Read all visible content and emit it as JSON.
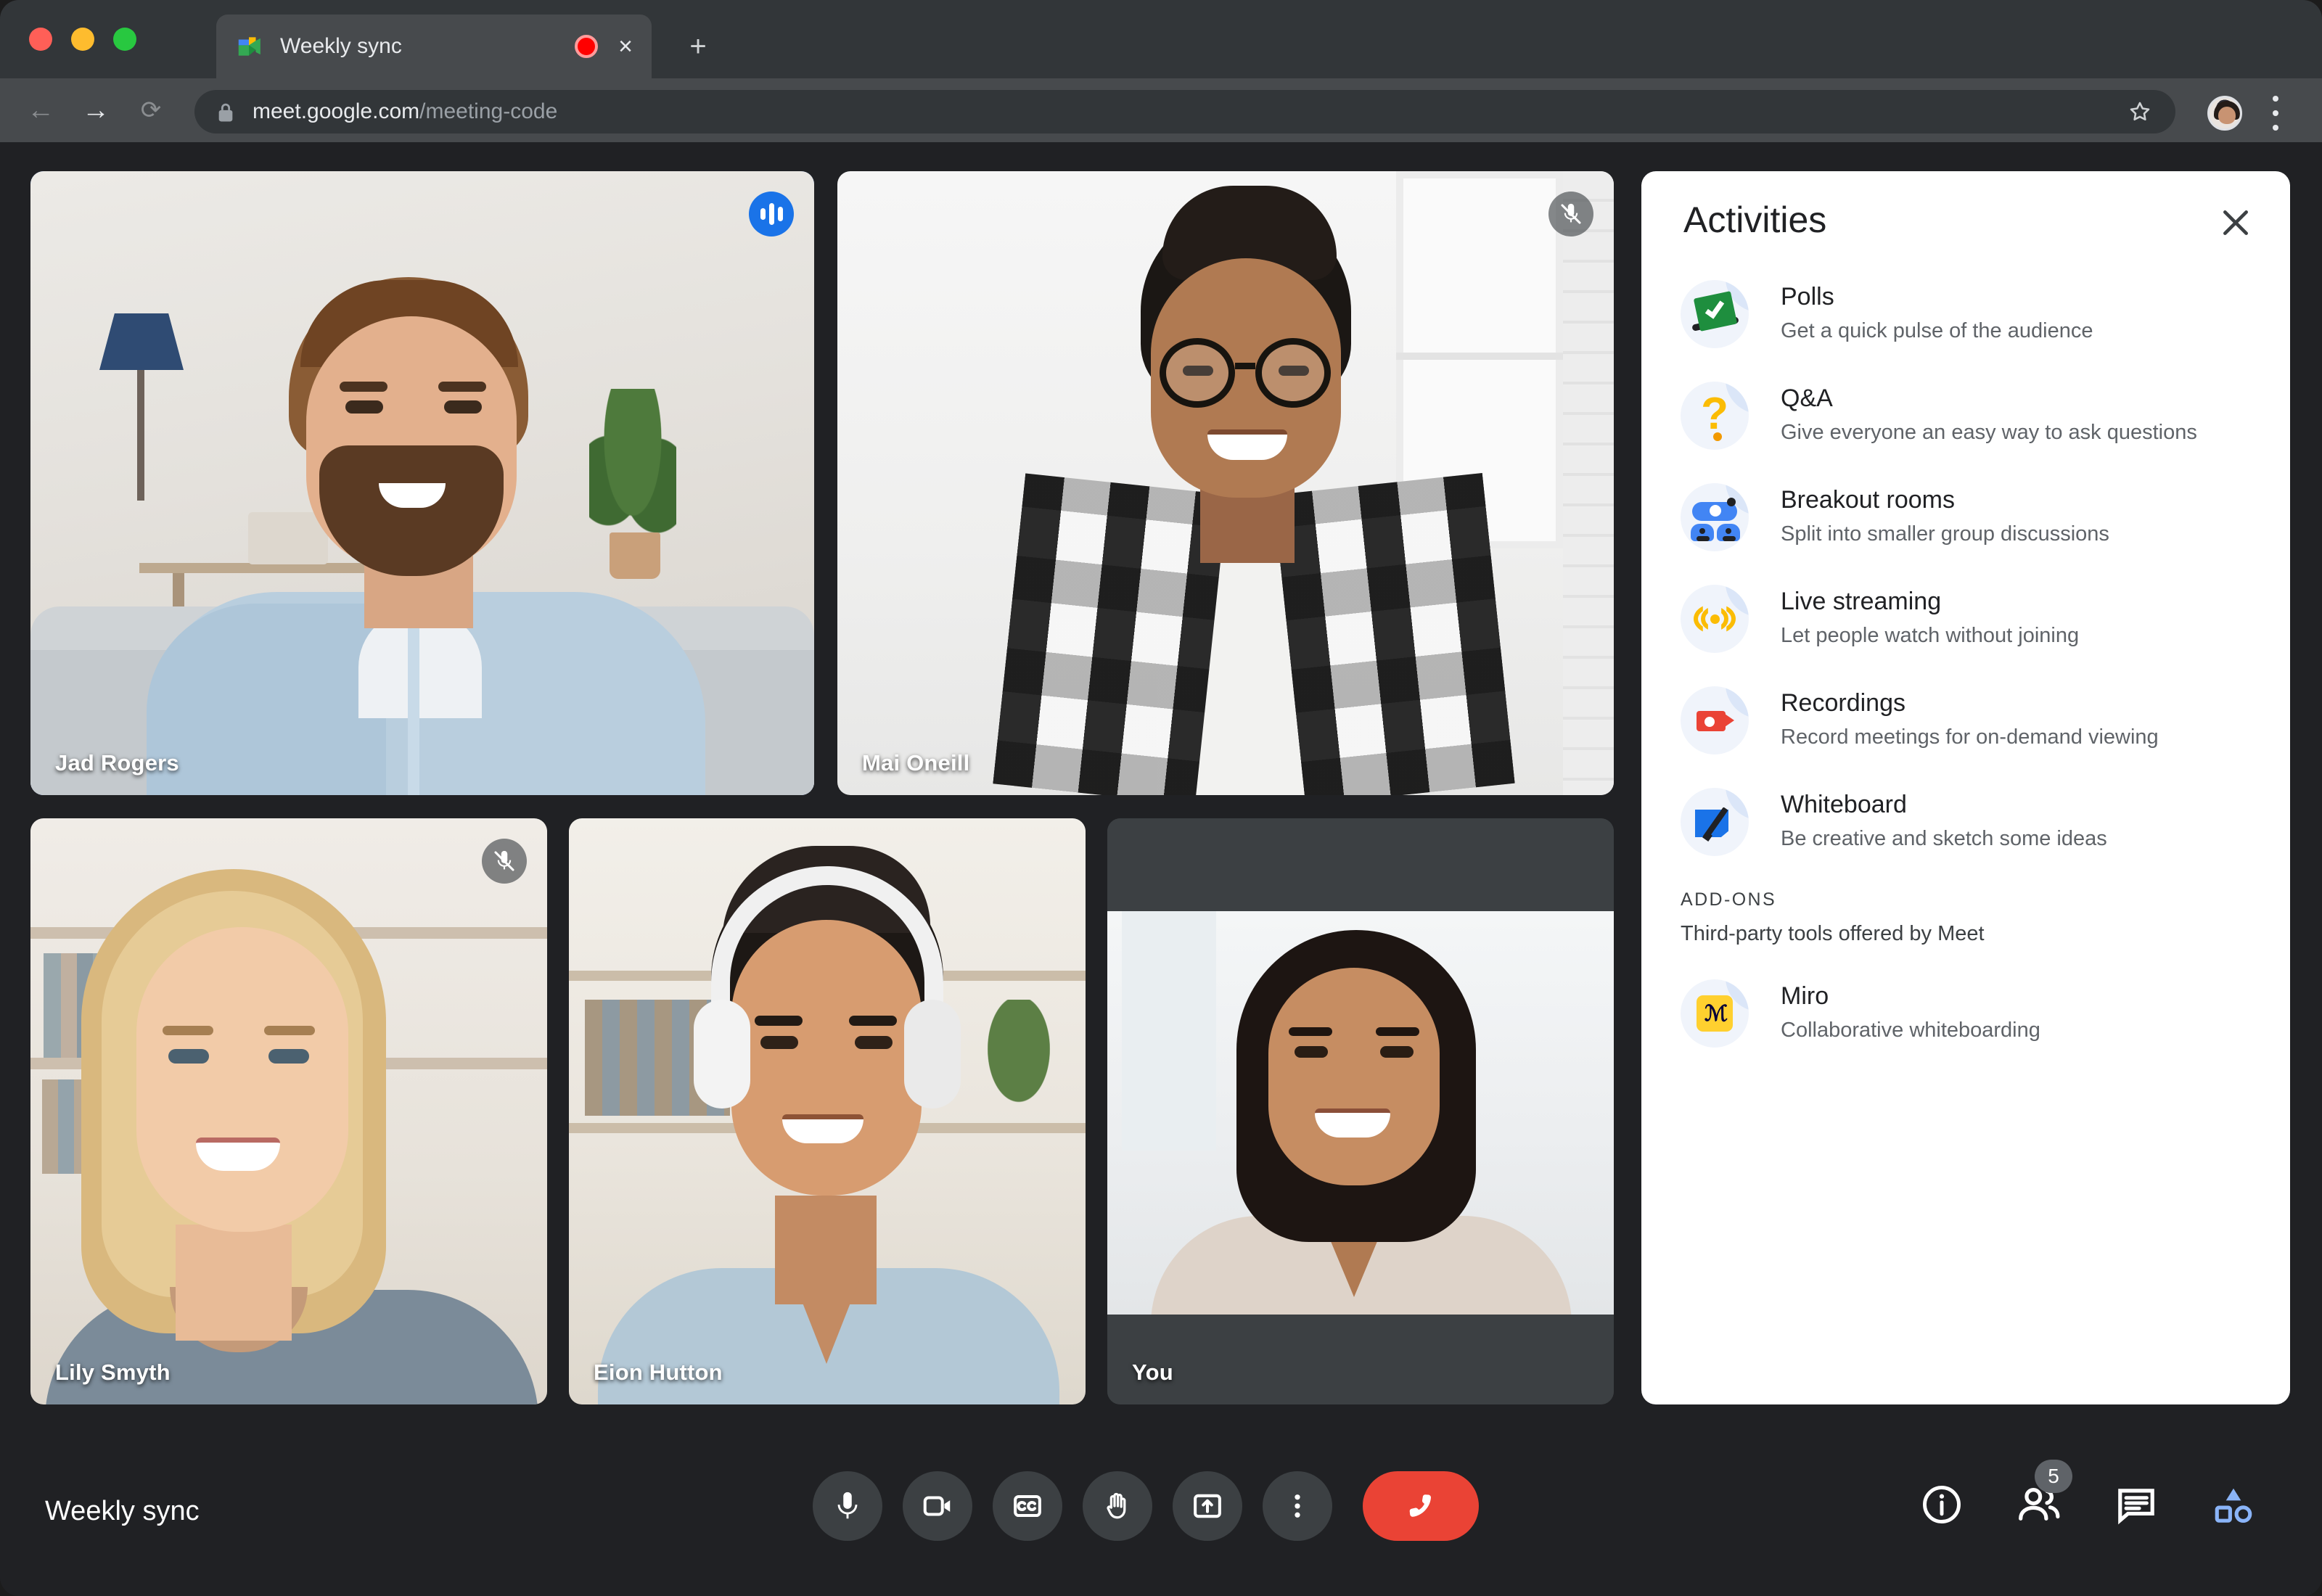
{
  "browser": {
    "tab": {
      "title": "Weekly sync",
      "favicon": "google-meet-favicon",
      "recording_indicator": "recording-dot",
      "close_label": "×"
    },
    "new_tab_label": "+",
    "nav": {
      "back": "←",
      "forward": "→",
      "reload": "⟳"
    },
    "omnibox": {
      "lock": "lock-icon",
      "url_domain": "meet.google.com",
      "url_path": "/meeting-code",
      "bookmark": "star-icon"
    },
    "profile": "avatar",
    "menu": "chrome-menu-icon"
  },
  "meeting": {
    "title": "Weekly sync",
    "participants": [
      {
        "name": "Jad Rogers",
        "mic": "speaking",
        "active_speaker": true
      },
      {
        "name": "Mai Oneill",
        "mic": "muted",
        "active_speaker": false
      },
      {
        "name": "Lily Smyth",
        "mic": "muted",
        "active_speaker": false
      },
      {
        "name": "Eion Hutton",
        "mic": "none",
        "active_speaker": false
      },
      {
        "name": "You",
        "mic": "none",
        "active_speaker": false
      }
    ],
    "controls": [
      {
        "name": "microphone",
        "icon": "mic-icon"
      },
      {
        "name": "camera",
        "icon": "video-camera-icon"
      },
      {
        "name": "captions",
        "icon": "closed-captions-icon"
      },
      {
        "name": "raise-hand",
        "icon": "hand-icon"
      },
      {
        "name": "present",
        "icon": "present-screen-icon"
      },
      {
        "name": "more-options",
        "icon": "more-vertical-icon"
      },
      {
        "name": "leave-call",
        "icon": "hangup-phone-icon"
      }
    ],
    "right_controls": [
      {
        "name": "meeting-details",
        "icon": "info-icon",
        "badge": null
      },
      {
        "name": "people",
        "icon": "people-icon",
        "badge": "5"
      },
      {
        "name": "chat",
        "icon": "chat-bubble-icon",
        "badge": null
      },
      {
        "name": "activities",
        "icon": "activities-shapes-icon",
        "badge": null
      }
    ]
  },
  "panel": {
    "title": "Activities",
    "close": "close-icon",
    "items": [
      {
        "title": "Polls",
        "sub": "Get a quick pulse of the audience",
        "icon": "polls-icon"
      },
      {
        "title": "Q&A",
        "sub": "Give everyone an easy way to ask questions",
        "icon": "question-mark-icon"
      },
      {
        "title": "Breakout rooms",
        "sub": "Split into smaller group discussions",
        "icon": "breakout-rooms-icon"
      },
      {
        "title": "Live streaming",
        "sub": "Let people watch without joining",
        "icon": "live-streaming-icon"
      },
      {
        "title": "Recordings",
        "sub": "Record meetings for on-demand viewing",
        "icon": "recordings-icon"
      },
      {
        "title": "Whiteboard",
        "sub": "Be creative and sketch some ideas",
        "icon": "whiteboard-icon"
      }
    ],
    "addons": {
      "label": "ADD-ONS",
      "sub": "Third-party tools offered by Meet",
      "items": [
        {
          "title": "Miro",
          "sub": "Collaborative whiteboarding",
          "icon": "miro-icon"
        }
      ]
    }
  },
  "colors": {
    "accent_blue": "#1a73e8",
    "active_border": "#5e9bff",
    "hangup_red": "#ea4335",
    "panel_bg": "#ffffff",
    "app_bg": "#202124",
    "tile_bg": "#3c4043"
  }
}
